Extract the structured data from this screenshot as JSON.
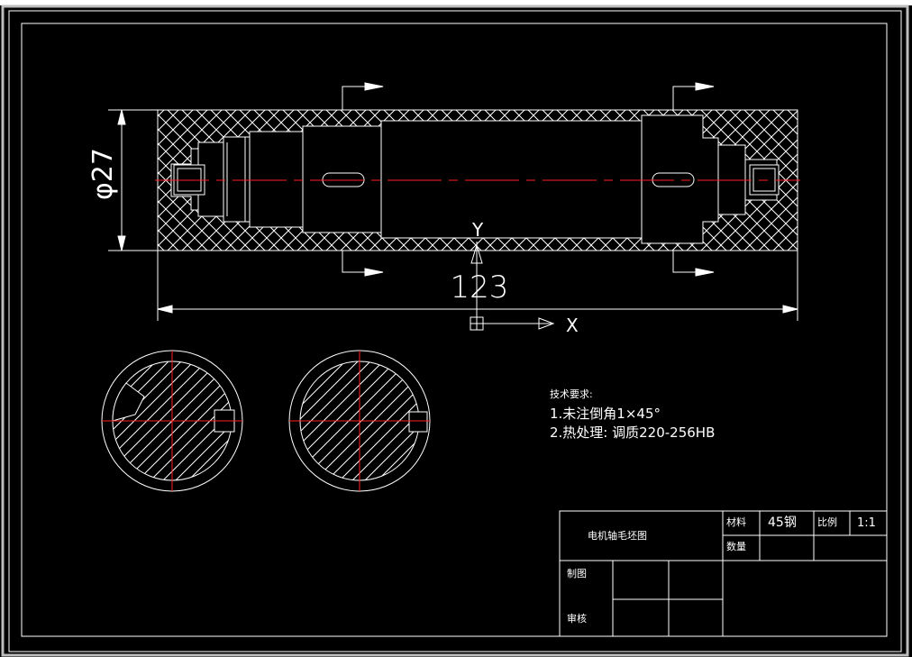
{
  "drawing": {
    "dimension_diameter": "φ27",
    "dimension_length": "123",
    "ucs_y_label": "Y",
    "ucs_x_label": "X"
  },
  "tech_requirements": {
    "title": "技术要求:",
    "item1": "1.未注倒角1×45°",
    "item2": "2.热处理: 调质220-256HB"
  },
  "title_block": {
    "drawing_name": "电机轴毛坯图",
    "material_label": "材料",
    "material_value": "45钢",
    "scale_label": "比例",
    "scale_value": "1:1",
    "quantity_label": "数量",
    "drawn_by_label": "制图",
    "checked_by_label": "审核"
  },
  "colors": {
    "background": "#000000",
    "lines": "#ffffff",
    "centerline": "#ff2020",
    "frame_outer": "#c0c0c0"
  }
}
